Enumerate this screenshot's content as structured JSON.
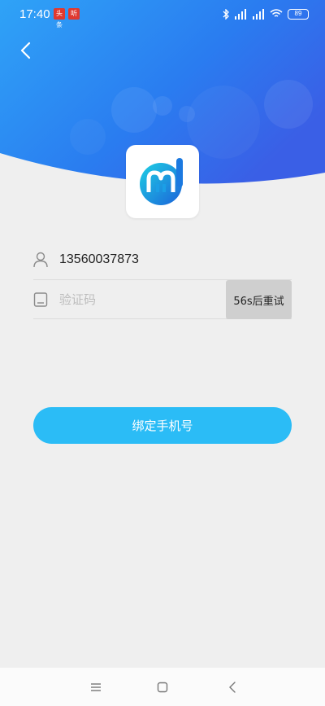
{
  "status_bar": {
    "time": "17:40",
    "app_badge_1": "头条",
    "app_badge_2": "听",
    "battery": "89"
  },
  "form": {
    "phone_value": "13560037873",
    "code_placeholder": "验证码",
    "retry_label": "56s后重试"
  },
  "bind_button_label": "绑定手机号",
  "colors": {
    "header_blue": "#2a7cf0",
    "button_blue": "#2bbcf6",
    "background": "#efefef"
  },
  "icons": [
    "back-arrow-icon",
    "user-icon",
    "tablet-icon",
    "menu-icon",
    "home-icon",
    "nav-back-icon"
  ]
}
